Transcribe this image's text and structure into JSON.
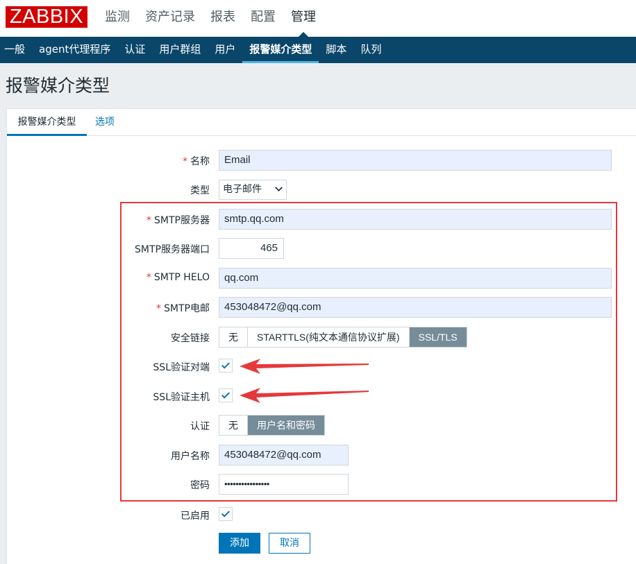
{
  "header": {
    "logo": "ZABBIX",
    "menu": [
      "监测",
      "资产记录",
      "报表",
      "配置",
      "管理"
    ],
    "active_menu": "管理"
  },
  "subnav": {
    "items": [
      "一般",
      "agent代理程序",
      "认证",
      "用户群组",
      "用户",
      "报警媒介类型",
      "脚本",
      "队列"
    ],
    "active": "报警媒介类型"
  },
  "page_title": "报警媒介类型",
  "tabs": [
    "报警媒介类型",
    "选项"
  ],
  "form": {
    "name_label": "名称",
    "name_value": "Email",
    "type_label": "类型",
    "type_value": "电子邮件",
    "smtp_server_label": "SMTP服务器",
    "smtp_server_value": "smtp.qq.com",
    "smtp_port_label": "SMTP服务器端口",
    "smtp_port_value": "465",
    "smtp_helo_label": "SMTP HELO",
    "smtp_helo_value": "qq.com",
    "smtp_email_label": "SMTP电邮",
    "smtp_email_value": "453048472@qq.com",
    "security_label": "安全链接",
    "security_options": [
      "无",
      "STARTTLS(纯文本通信协议扩展)",
      "SSL/TLS"
    ],
    "security_selected": "SSL/TLS",
    "ssl_verify_peer_label": "SSL验证对端",
    "ssl_verify_peer_checked": true,
    "ssl_verify_host_label": "SSL验证主机",
    "ssl_verify_host_checked": true,
    "auth_label": "认证",
    "auth_options": [
      "无",
      "用户名和密码"
    ],
    "auth_selected": "用户名和密码",
    "username_label": "用户名称",
    "username_value": "453048472@qq.com",
    "password_label": "密码",
    "password_value": "••••••••••••••••",
    "enabled_label": "已启用",
    "enabled_checked": true,
    "required_mark": "*"
  },
  "buttons": {
    "add": "添加",
    "cancel": "取消"
  },
  "colors": {
    "brand": "#d40000",
    "subnav_bg": "#0a466a",
    "accent": "#0275b8",
    "highlight": "#e5383b"
  }
}
